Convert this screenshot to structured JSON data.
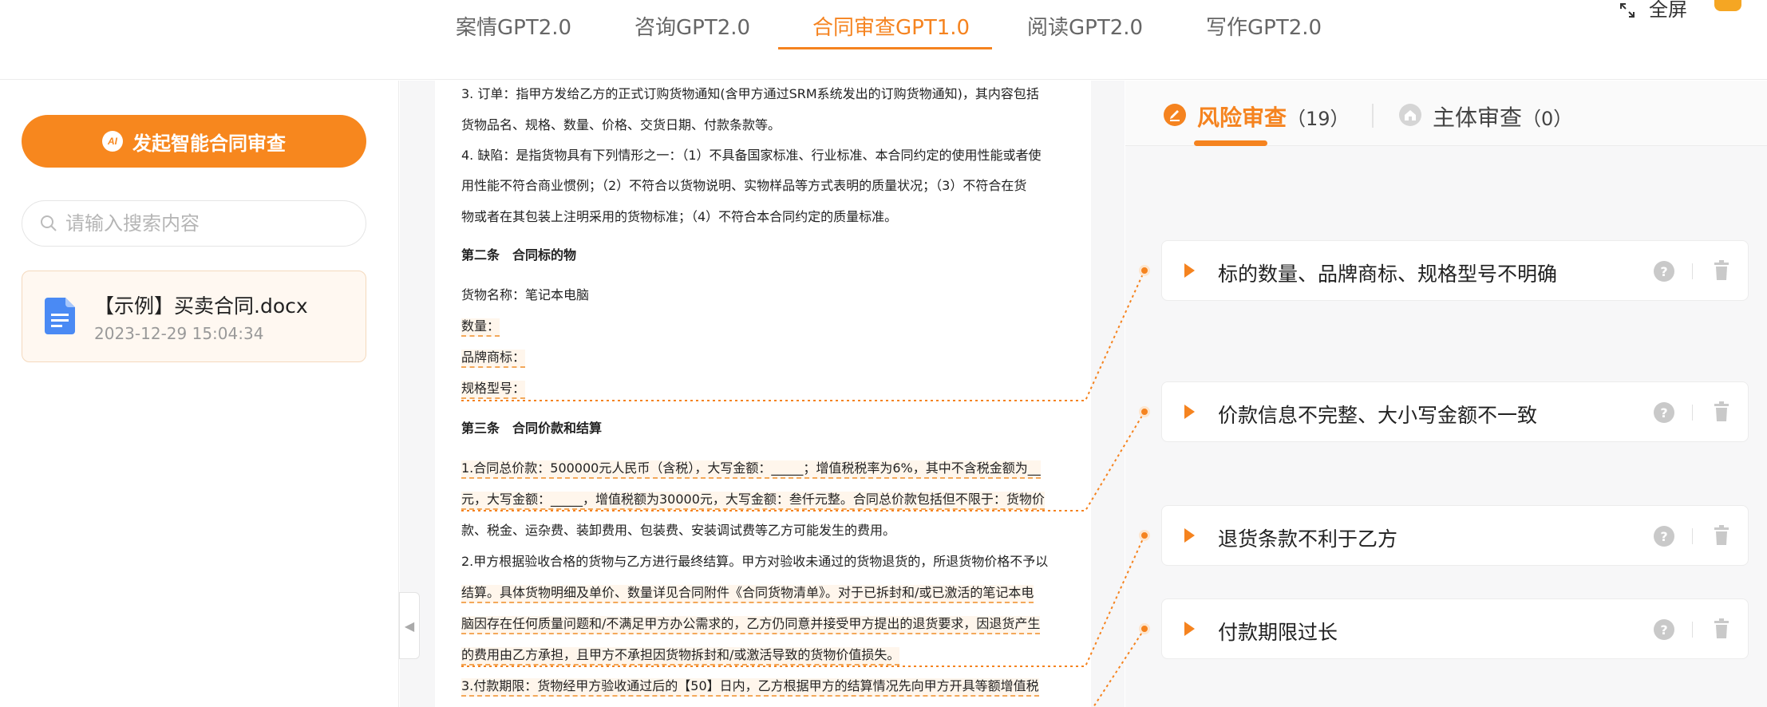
{
  "nav": {
    "tabs": [
      {
        "label": "案情GPT2.0"
      },
      {
        "label": "咨询GPT2.0"
      },
      {
        "label": "合同审查GPT1.0"
      },
      {
        "label": "阅读GPT2.0"
      },
      {
        "label": "写作GPT2.0"
      }
    ],
    "active_tab": "合同审查GPT1.0",
    "fullscreen_label": "全屏"
  },
  "sidebar": {
    "start_button": "发起智能合同审查",
    "start_button_icon": "AI",
    "search_placeholder": "请输入搜索内容",
    "file": {
      "name": "【示例】买卖合同.docx",
      "date": "2023-12-29 15:04:34"
    }
  },
  "document": {
    "lines": [
      "3. 订单：指甲方发给乙方的正式订购货物通知(含甲方通过SRM系统发出的订购货物通知)，其内容包括",
      "货物品名、规格、数量、价格、交货日期、付款条款等。",
      "4. 缺陷：是指货物具有下列情形之一：（1）不具备国家标准、行业标准、本合同约定的使用性能或者使",
      "用性能不符合商业惯例；（2）不符合以货物说明、实物样品等方式表明的质量状况；（3）不符合在货",
      "物或者在其包装上注明采用的货物标准；（4）不符合本合同约定的质量标准。",
      "第二条　合同标的物",
      "货物名称：笔记本电脑",
      "数量：",
      "品牌商标：",
      "规格型号：",
      "第三条　合同价款和结算",
      "1.合同总价款：500000元人民币（含税），大写金额：_____；增值税税率为6%，其中不含税金额为__",
      "元，大写金额：_____，增值税额为30000元，大写金额：叁仟元整。合同总价款包括但不限于：货物价",
      "款、税金、运杂费、装卸费用、包装费、安装调试费等乙方可能发生的费用。",
      "2.甲方根据验收合格的货物与乙方进行最终结算。甲方对验收未通过的货物退货的，所退货物价格不予以",
      "结算。具体货物明细及单价、数量详见合同附件《合同货物清单》。对于已拆封和/或已激活的笔记本电",
      "脑因存在任何质量问题和/不满足甲方办公需求的，乙方仍同意并接受甲方提出的退货要求，因退货产生",
      "的费用由乙方承担，且甲方不承担因货物拆封和/或激活导致的货物价值损失。",
      "3.付款期限：货物经甲方验收通过后的【50】日内，乙方根据甲方的结算情况先向甲方开具等额增值税"
    ]
  },
  "review": {
    "tabs": [
      {
        "label": "风险审查",
        "count": "（19）"
      },
      {
        "label": "主体审查",
        "count": "（0）"
      }
    ],
    "risks": [
      {
        "title": "标的数量、品牌商标、规格型号不明确"
      },
      {
        "title": "价款信息不完整、大小写金额不一致"
      },
      {
        "title": "退货条款不利于乙方"
      },
      {
        "title": "付款期限过长"
      }
    ],
    "help_glyph": "?"
  },
  "colors": {
    "accent": "#f5831f",
    "highlight_border": "#f3a85a",
    "highlight_bg": "#fff6ec"
  }
}
